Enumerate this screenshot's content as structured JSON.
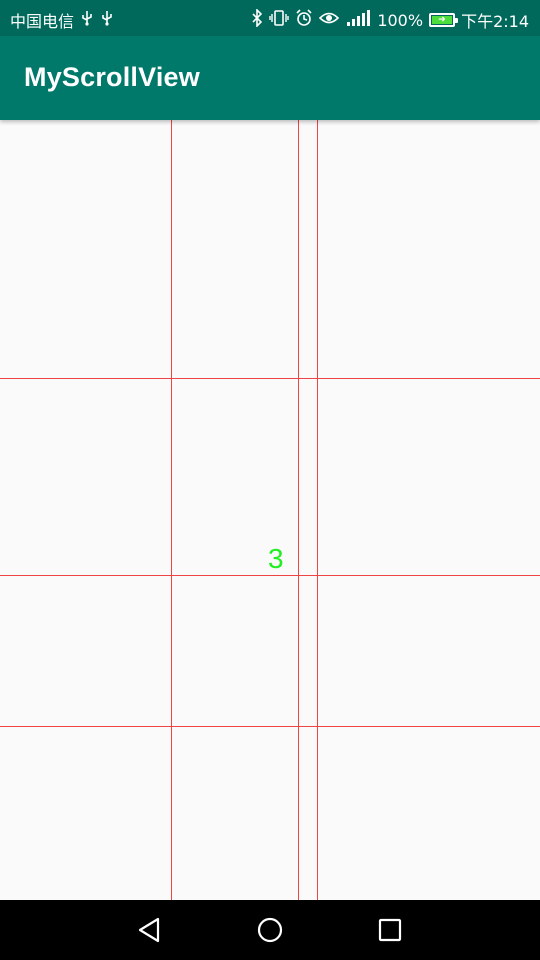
{
  "status_bar": {
    "carrier": "中国电信",
    "left_icons": [
      "usb-icon",
      "usb-icon"
    ],
    "right_icons": [
      "bluetooth-icon",
      "vibrate-icon",
      "alarm-icon",
      "eye-icon",
      "signal-icon"
    ],
    "battery_percent": "100%",
    "battery_level": 1.0,
    "battery_color": "#4cde3a",
    "time": "下午2:14",
    "background_color": "#00695c"
  },
  "app_bar": {
    "title": "MyScrollView",
    "background_color": "#00796b"
  },
  "content": {
    "number": "3",
    "number_color": "#22ee22",
    "grid_line_color": "#ef4444"
  },
  "nav_bar": {
    "buttons": [
      "back-icon",
      "home-icon",
      "recents-icon"
    ]
  }
}
